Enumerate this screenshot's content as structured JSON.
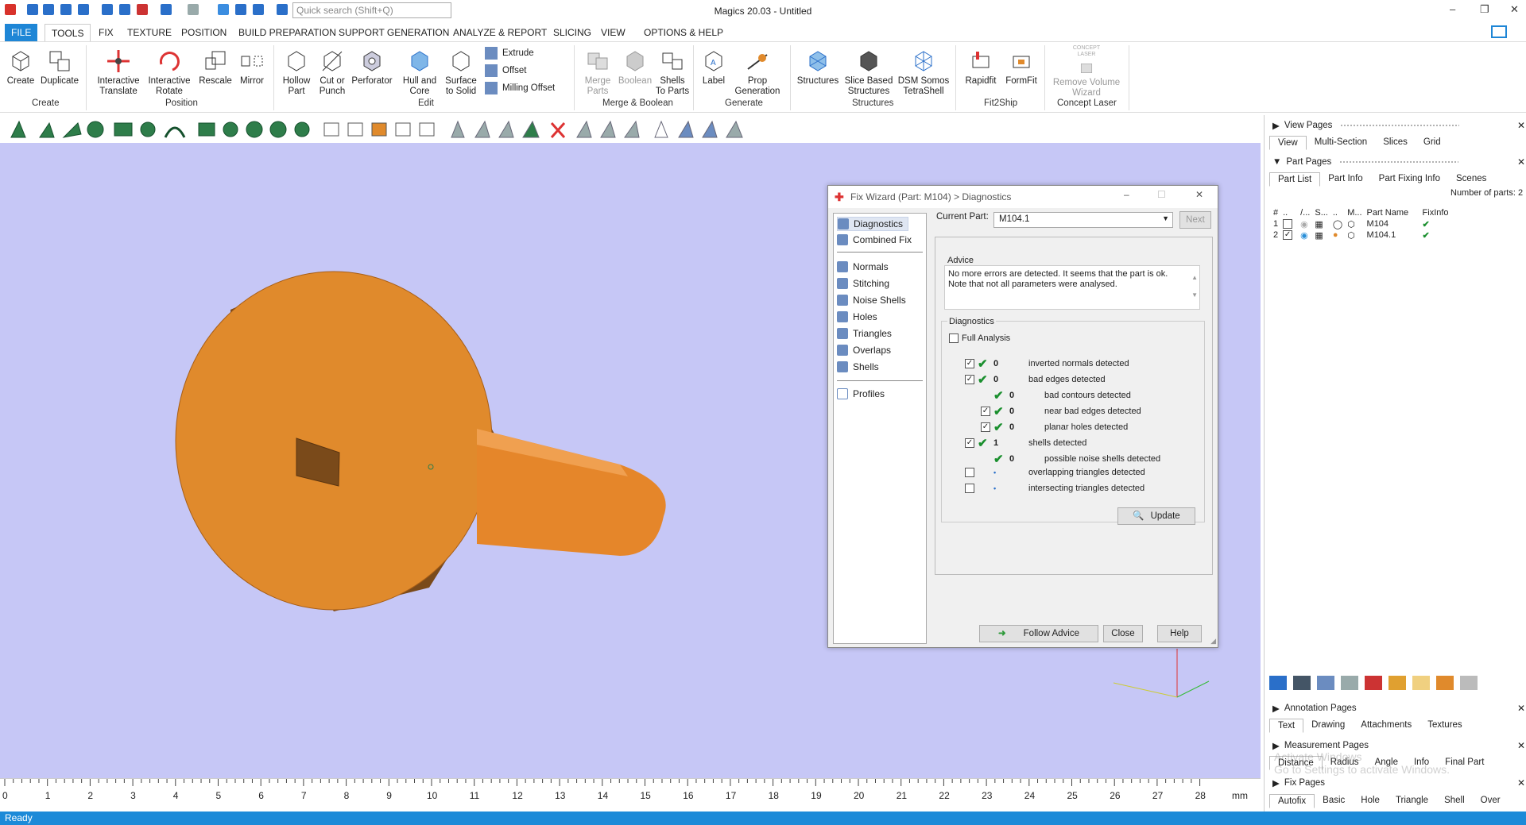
{
  "app": {
    "title": "Magics 20.03 - Untitled",
    "search_placeholder": "Quick search (Shift+Q)"
  },
  "menu": [
    "FILE",
    "TOOLS",
    "TEXTURE",
    "FIX",
    "POSITION",
    "BUILD PREPARATION",
    "SUPPORT GENERATION",
    "ANALYZE & REPORT",
    "SLICING",
    "VIEW",
    "OPTIONS & HELP"
  ],
  "ribbon": {
    "create": {
      "create": "Create",
      "duplicate": "Duplicate",
      "group": "Create"
    },
    "position": {
      "interactive_translate": "Interactive\nTranslate",
      "interactive_rotate": "Interactive\nRotate",
      "rescale": "Rescale",
      "mirror": "Mirror",
      "group": "Position"
    },
    "edit": {
      "hollow_part": "Hollow\nPart",
      "cut_or_punch": "Cut or\nPunch",
      "perforator": "Perforator",
      "hull_and_core": "Hull and\nCore",
      "surface_to_solid": "Surface\nto Solid",
      "extrude": "Extrude",
      "offset": "Offset",
      "milling_offset": "Milling Offset",
      "group": "Edit"
    },
    "merge": {
      "merge_parts": "Merge\nParts",
      "boolean": "Boolean",
      "shells_to_parts": "Shells\nTo Parts",
      "group": "Merge & Boolean"
    },
    "generate": {
      "label": "Label",
      "prop_generation": "Prop\nGeneration",
      "group": "Generate"
    },
    "structures": {
      "structures": "Structures",
      "slice_based": "Slice Based\nStructures",
      "dsm": "DSM Somos\nTetraShell",
      "group": "Structures"
    },
    "fit2ship": {
      "rapidfit": "Rapidfit",
      "formfit": "FormFit",
      "group": "Fit2Ship"
    },
    "concept": {
      "logo": "CONCEPT\nLASER",
      "remove_volume": "Remove Volume\nWizard",
      "group": "Concept Laser"
    }
  },
  "dialog": {
    "title": "Fix Wizard (Part: M104) > Diagnostics",
    "nav": [
      "Diagnostics",
      "Combined Fix",
      "Normals",
      "Stitching",
      "Noise Shells",
      "Holes",
      "Triangles",
      "Overlaps",
      "Shells",
      "Profiles"
    ],
    "current_part_label": "Current Part:",
    "current_part": "M104.1",
    "next": "Next",
    "advice_label": "Advice",
    "advice_text": "No more errors are detected. It seems that the part is ok. Note that not all parameters were analysed.",
    "diagnostics_label": "Diagnostics",
    "full_analysis": "Full Analysis",
    "rows": [
      {
        "value": "0",
        "text": "inverted normals detected"
      },
      {
        "value": "0",
        "text": "bad edges detected"
      },
      {
        "value": "0",
        "text": "bad contours detected"
      },
      {
        "value": "0",
        "text": "near bad edges detected"
      },
      {
        "value": "0",
        "text": "planar holes detected"
      },
      {
        "value": "1",
        "text": "shells detected"
      },
      {
        "value": "0",
        "text": "possible noise shells detected"
      },
      {
        "value": "•",
        "text": "overlapping triangles detected"
      },
      {
        "value": "•",
        "text": "intersecting triangles detected"
      }
    ],
    "update": "Update",
    "follow_advice": "Follow Advice",
    "close": "Close",
    "help": "Help"
  },
  "right": {
    "view_pages": "View Pages",
    "view_tabs": [
      "View",
      "Multi-Section",
      "Slices",
      "Grid"
    ],
    "part_pages": "Part Pages",
    "part_tabs": [
      "Part List",
      "Part Info",
      "Part Fixing Info",
      "Scenes"
    ],
    "num_parts": "Number of parts: 2",
    "columns": [
      "#",
      "..",
      "/...",
      "S...",
      "..",
      "M...",
      "Part Name",
      "FixInfo"
    ],
    "parts": [
      {
        "n": "1",
        "name": "M104"
      },
      {
        "n": "2",
        "name": "M104.1"
      }
    ],
    "annotation_pages": "Annotation Pages",
    "annotation_tabs": [
      "Text",
      "Drawing",
      "Attachments",
      "Textures"
    ],
    "measurement_pages": "Measurement Pages",
    "measurement_tabs": [
      "Distance",
      "Radius",
      "Angle",
      "Info",
      "Final Part"
    ],
    "fix_pages": "Fix Pages",
    "fix_tabs": [
      "Autofix",
      "Basic",
      "Hole",
      "Triangle",
      "Shell",
      "Over"
    ],
    "watermark": "Activate Windows\nGo to Settings to activate Windows."
  },
  "ruler": {
    "ticks": [
      "0",
      "1",
      "2",
      "3",
      "4",
      "5",
      "6",
      "7",
      "8",
      "9",
      "10",
      "11",
      "12",
      "13",
      "14",
      "15",
      "16",
      "17",
      "18",
      "19",
      "20",
      "21",
      "22",
      "23",
      "24",
      "25",
      "26",
      "27",
      "28"
    ],
    "unit": "mm"
  },
  "status": "Ready",
  "colors": {
    "accent": "#1e86d6",
    "viewport": "#c6c7f6",
    "part": "#e08a2c",
    "check": "#1a8f2e"
  }
}
